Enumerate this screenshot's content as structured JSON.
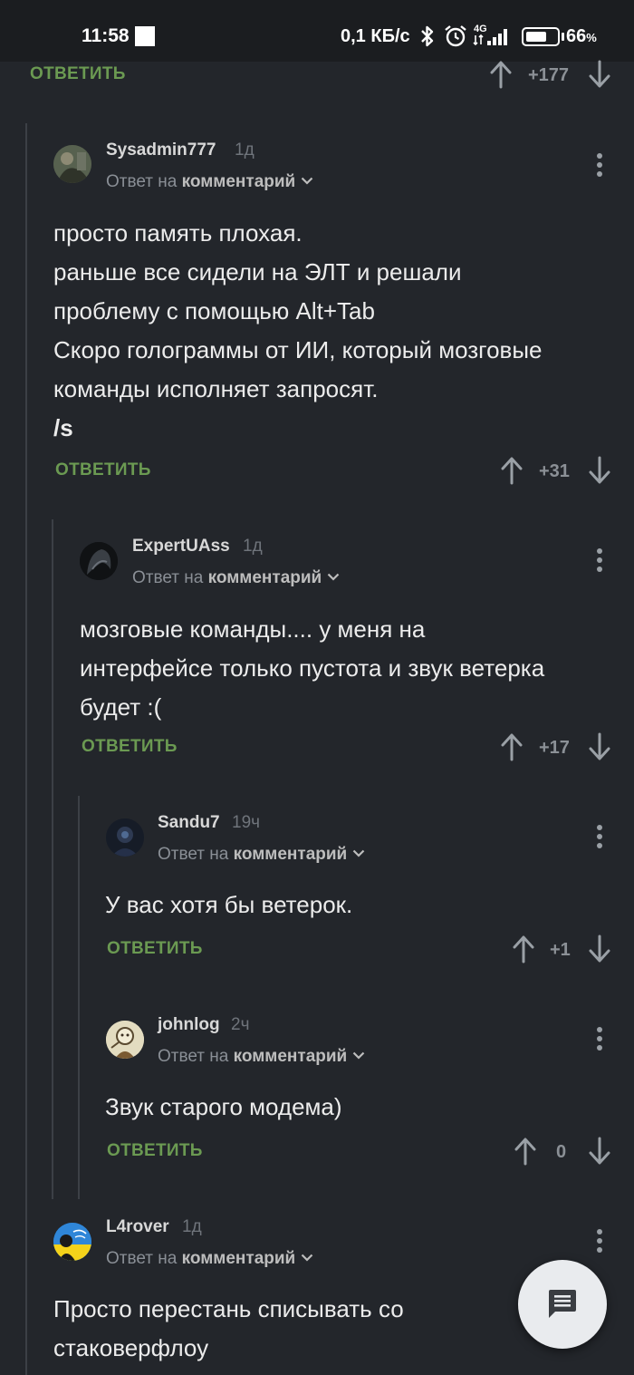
{
  "status_bar": {
    "time": "11:58",
    "net_speed": "0,1 КБ/с",
    "network_type": "4G",
    "battery_percent": "66",
    "battery_unit": "%",
    "battery_level": 0.66,
    "icons": [
      "bluetooth-icon",
      "alarm-icon",
      "signal-icon",
      "battery-icon"
    ]
  },
  "top_item": {
    "reply_label": "ОТВЕТИТЬ",
    "score": "+177"
  },
  "comments": [
    {
      "username": "Sysadmin777",
      "time": "1д",
      "reply_prefix": "Ответ на",
      "reply_target": "комментарий",
      "lines": [
        "просто память плохая.",
        "раньше все сидели на ЭЛТ и решали",
        "проблему с помощью Alt+Tab",
        "Скоро голограммы от ИИ, который мозговые",
        "команды исполняет запросят."
      ],
      "bold_line": "/s",
      "reply_label": "ОТВЕТИТЬ",
      "score": "+31"
    },
    {
      "username": "ExpertUAss",
      "time": "1д",
      "reply_prefix": "Ответ на",
      "reply_target": "комментарий",
      "lines": [
        "мозговые команды.... у меня на",
        "интерфейсе только пустота и звук ветерка",
        "будет :("
      ],
      "reply_label": "ОТВЕТИТЬ",
      "score": "+17"
    },
    {
      "username": "Sandu7",
      "time": "19ч",
      "reply_prefix": "Ответ на",
      "reply_target": "комментарий",
      "lines": [
        "У вас хотя бы ветерок."
      ],
      "reply_label": "ОТВЕТИТЬ",
      "score": "+1"
    },
    {
      "username": "johnlog",
      "time": "2ч",
      "reply_prefix": "Ответ на",
      "reply_target": "комментарий",
      "lines": [
        "Звук старого модема)"
      ],
      "reply_label": "ОТВЕТИТЬ",
      "score": "0"
    },
    {
      "username": "L4rover",
      "time": "1д",
      "reply_prefix": "Ответ на",
      "reply_target": "комментарий",
      "lines": [
        "Просто перестань списывать со",
        "стаковерфлоу"
      ]
    }
  ],
  "colors": {
    "background": "#23262b",
    "status_bar": "#1b1d20",
    "reply_green": "#6b9a52",
    "muted_text": "#8a8f96",
    "fab": "#e9ebee"
  },
  "fab": {
    "icon": "comment-icon"
  }
}
